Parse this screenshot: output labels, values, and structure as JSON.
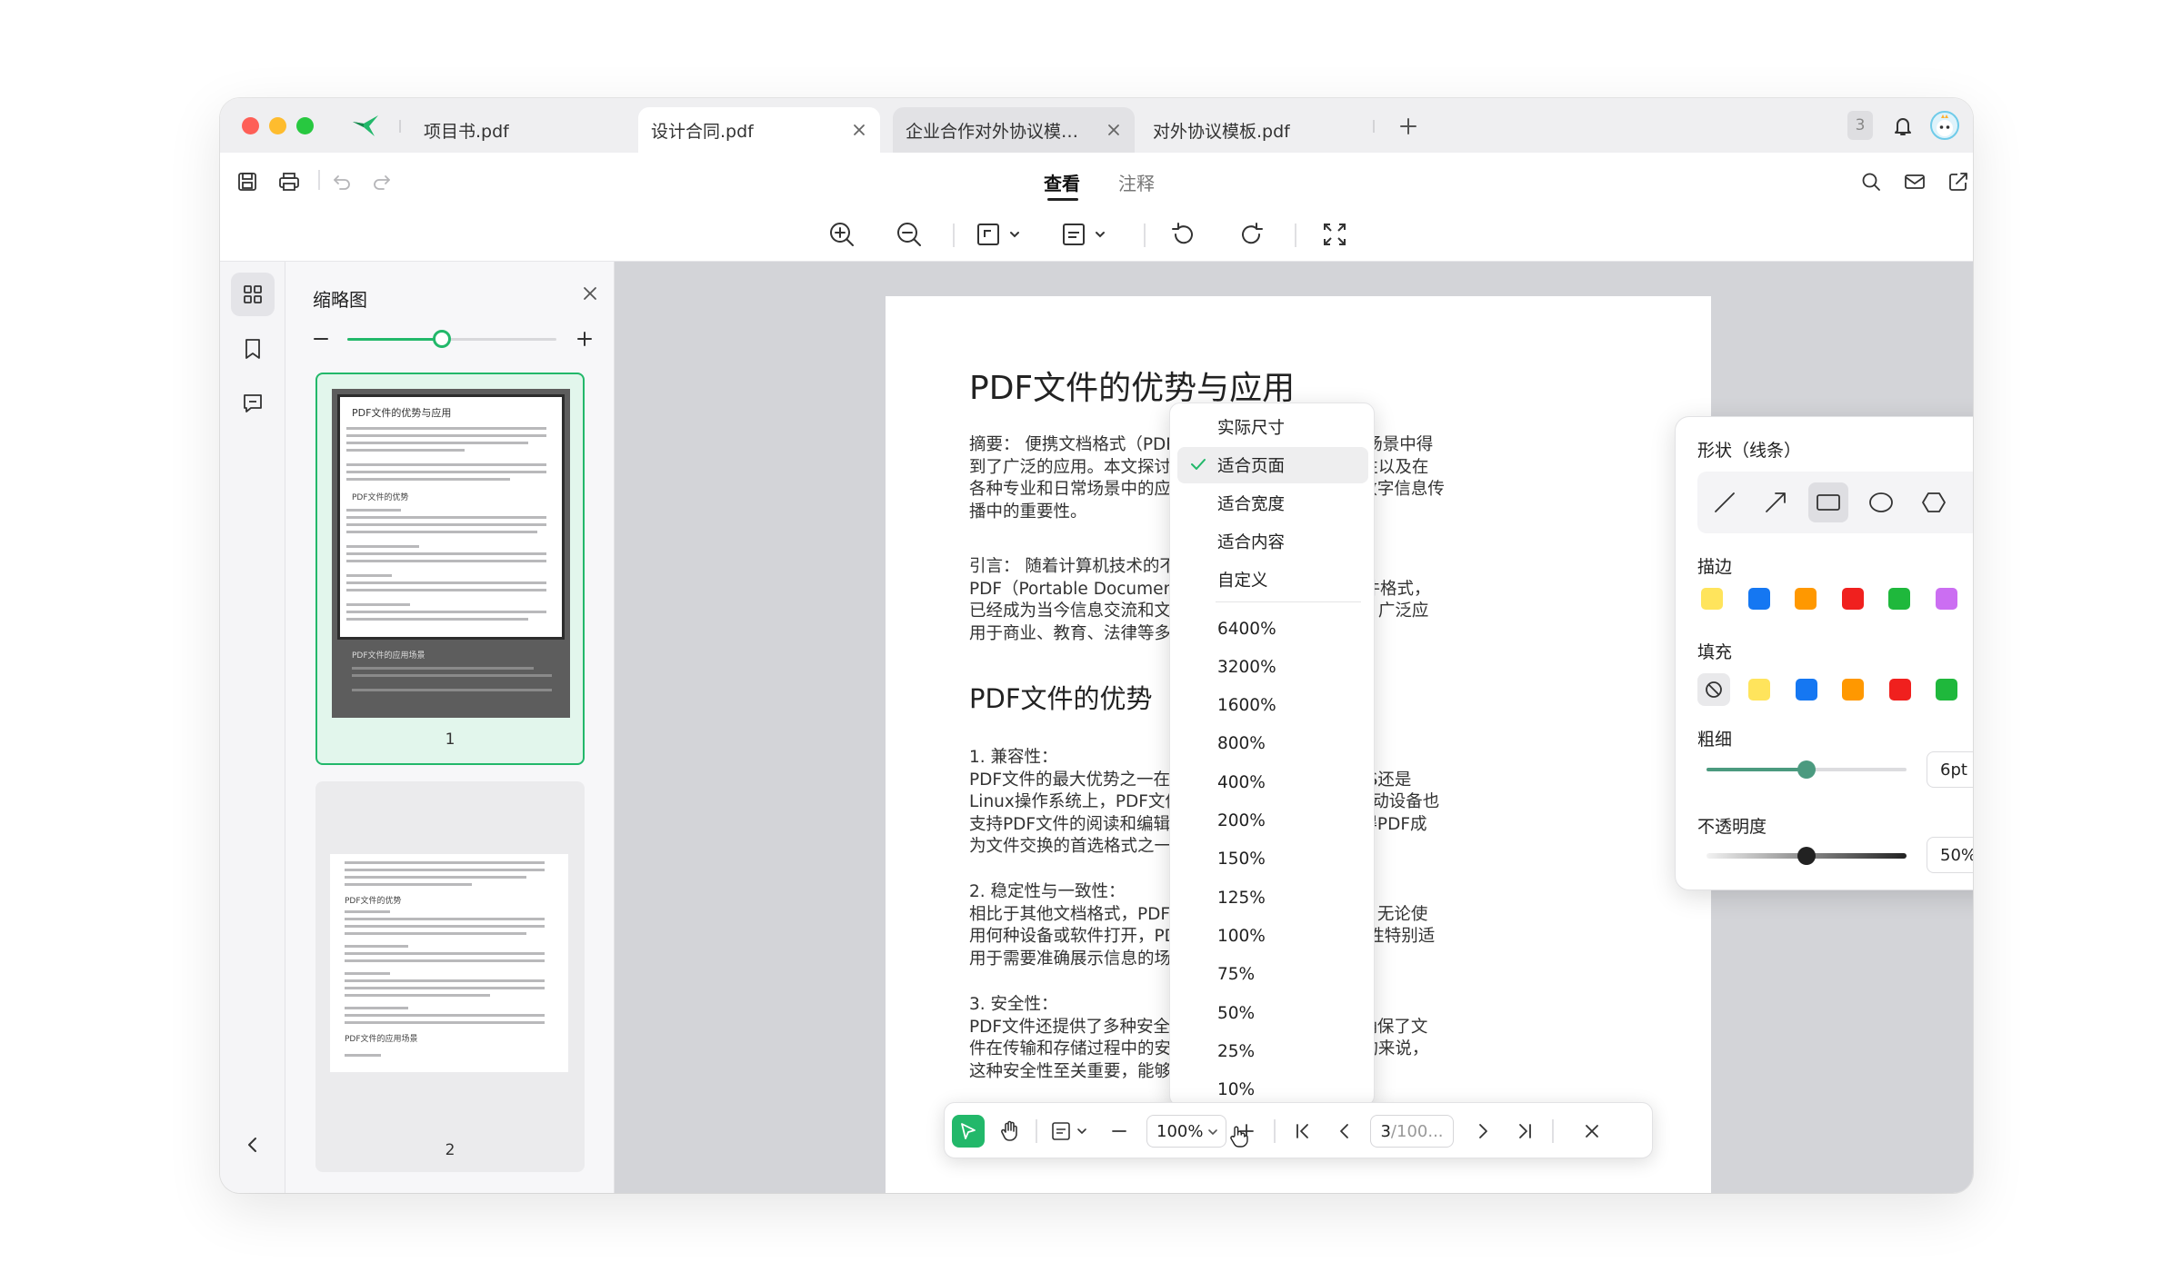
{
  "tabs": [
    {
      "label": "项目书.pdf"
    },
    {
      "label": "设计合同.pdf"
    },
    {
      "label": "企业合作对外协议模板..."
    },
    {
      "label": "对外协议模板.pdf"
    }
  ],
  "notification_count": "3",
  "mode_tabs": {
    "view": "查看",
    "annotate": "注释"
  },
  "thumbnails": {
    "title": "缩略图",
    "pages": [
      {
        "number": "1",
        "heading1": "PDF文件的优势与应用",
        "heading2": "PDF文件的优势",
        "heading3": "PDF文件的应用场景"
      },
      {
        "number": "2",
        "heading1": "PDF文件的优势",
        "heading2": "PDF文件的应用场景"
      }
    ],
    "slider_level": 0.45
  },
  "document": {
    "title": "PDF文件的优势与应用",
    "abstract": "摘要： 便携文档格式（PDF                              格式，自诞生以来在各类场景中得\n到了广泛的应用。本文探讨                              其兼容性、稳定性、安全性以及在\n各种专业和日常场景中的应                              。本文强调了PDF文件在数字信息传\n播中的重要性。",
    "intro": "引言： 随着计算机技术的不                              样性也在不断增加。\nPDF（Portable Document                              于1993年推出的一种文件格式，\n已经成为当今信息交流和文                              度远远超过了最初的预期，广泛应\n用于商业、教育、法律等多",
    "section": "PDF文件的优势",
    "p1": "1. 兼容性：\nPDF文件的最大优势之一在                              论是在Windows、macOS还是\nLinux操作系统上，PDF文件                              展示效果。此外，各类移动设备也\n支持PDF文件的阅读和编辑                              文件格式。这种兼容性使得PDF成\n为文件交换的首选格式之一                              式的场景中。",
    "p2": "2. 稳定性与一致性：\n相比于其他文档格式，PDF                              能保持高一致性和稳定性。无论使\n用何种设备或软件打开，PD                              不会发生变化。这种稳定性特别适\n用于需要准确展示信息的场                              图纸等。",
    "p3": "3. 安全性：\nPDF文件还提供了多种安全                              和数字签名等。这些功能确保了文\n件在传输和存储过程中的安                              篡改。对于企业和政府机构来说，\n这种安全性至关重要，能够"
  },
  "zoom_menu": {
    "fit_options": [
      "实际尺寸",
      "适合页面",
      "适合宽度",
      "适合内容",
      "自定义"
    ],
    "selected": "适合页面",
    "percents": [
      "6400%",
      "3200%",
      "1600%",
      "800%",
      "400%",
      "200%",
      "150%",
      "125%",
      "100%",
      "75%",
      "50%",
      "25%",
      "10%"
    ]
  },
  "shape_panel": {
    "title": "形状（线条）",
    "stroke_label": "描边",
    "fill_label": "填充",
    "weight_label": "粗细",
    "weight_value": "6pt",
    "weight_level": 0.5,
    "opacity_label": "不透明度",
    "opacity_value": "50%",
    "opacity_level": 0.5,
    "stroke_colors": [
      "#ffe45c",
      "#1577f2",
      "#ff9800",
      "#f0201e",
      "#1fb83c",
      "#cb6ef2"
    ],
    "fill_colors": [
      "#ffe45c",
      "#1577f2",
      "#ff9800",
      "#f0201e",
      "#1fb83c"
    ]
  },
  "bottom_bar": {
    "zoom": "100%",
    "page_current": "3",
    "page_total": "100..."
  },
  "colors": {
    "accent": "#22b86a"
  }
}
